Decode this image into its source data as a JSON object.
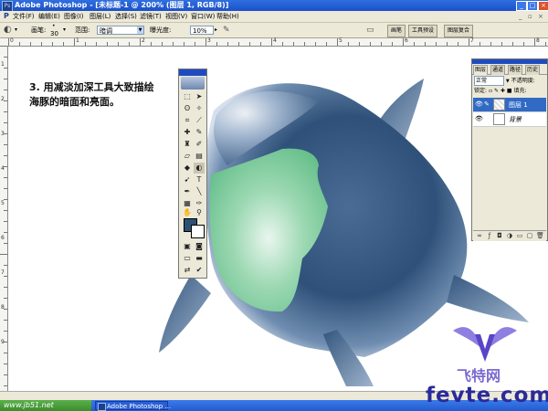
{
  "window": {
    "title": "Adobe Photoshop - [未标题-1 @ 200% (图层 1, RGB/8)]",
    "controls": [
      "_",
      "□",
      "×"
    ]
  },
  "menu": {
    "items": [
      "文件(F)",
      "编辑(E)",
      "图像(I)",
      "图层(L)",
      "选择(S)",
      "滤镜(T)",
      "视图(V)",
      "窗口(W)",
      "帮助(H)"
    ]
  },
  "options_bar": {
    "brush_label": "画笔:",
    "brush_size": "30",
    "range_label": "范围:",
    "range_value": "暗调",
    "exposure_label": "曝光度:",
    "exposure_value": "10%",
    "palette_tabs": [
      "画笔",
      "工具预设",
      "图层复合"
    ]
  },
  "rulers": {
    "top_numbers": [
      "0",
      "1",
      "2",
      "3",
      "4",
      "5",
      "6",
      "7",
      "8"
    ],
    "left_numbers": [
      "1",
      "2",
      "3",
      "4",
      "5",
      "6",
      "7",
      "8",
      "9"
    ]
  },
  "canvas": {
    "instruction_line1": "3. 用减淡加深工具大致描绘",
    "instruction_line2": "海豚的暗面和亮面。"
  },
  "tools_palette": {
    "foreground_color": "#2d4f74",
    "background_color": "#ffffff"
  },
  "layers_panel": {
    "tabs": [
      "图层",
      "通道",
      "路径",
      "历史"
    ],
    "blend_mode": "正常",
    "opacity_label": "不透明度:",
    "lock_label": "锁定:",
    "fill_label": "填充:",
    "layers": [
      {
        "name": "图层 1",
        "selected": true
      },
      {
        "name": "背景",
        "selected": false
      }
    ]
  },
  "taskbar": {
    "start_text": "www.jb51.net",
    "task_label": "Adobe Photoshop ..."
  },
  "watermark": {
    "logo_text": "飞特网",
    "site_text": "fevte.com"
  }
}
